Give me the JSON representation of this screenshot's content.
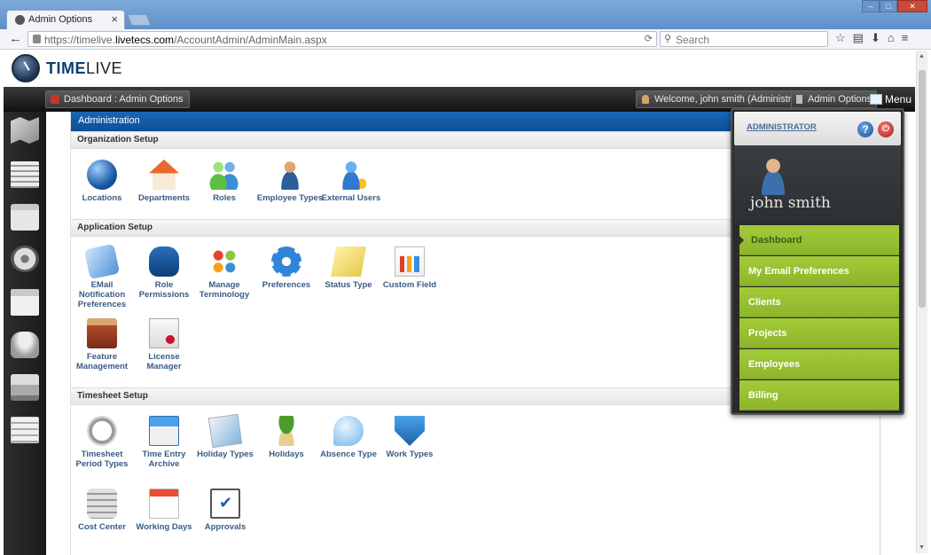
{
  "browser": {
    "tab_title": "Admin Options",
    "tab_close": "×",
    "url_prefix": "https://timelive.",
    "url_domain": "livetecs.com",
    "url_path": "/AccountAdmin/AdminMain.aspx",
    "search_placeholder": "Search",
    "back_glyph": "←",
    "reload_glyph": "⟳",
    "search_glyph": "⚲",
    "icons": [
      "☆",
      "▤",
      "⬇",
      "⌂",
      "≡"
    ],
    "window_buttons": [
      "–",
      "□",
      "✕"
    ]
  },
  "logo": {
    "part1": "TIME",
    "part2": "LIVE"
  },
  "topbar": {
    "breadcrumb": "Dashboard : Admin Options",
    "welcome": "Welcome, john smith (Administrator)",
    "admin_options": "Admin Options",
    "menu": "Menu"
  },
  "leftrail": {
    "icons": [
      "map-icon",
      "list-icon",
      "card-icon",
      "gauge-icon",
      "calendar-icon",
      "phone-icon",
      "printer-icon",
      "form-icon"
    ]
  },
  "admin": {
    "header": "Administration",
    "sections": {
      "organization": {
        "title": "Organization Setup",
        "items": [
          "Locations",
          "Departments",
          "Roles",
          "Employee Types",
          "External Users"
        ]
      },
      "application": {
        "title": "Application Setup",
        "items": [
          "EMail Notification Preferences",
          "Role Permissions",
          "Manage Terminology",
          "Preferences",
          "Status Type",
          "Custom Field",
          "Feature Management",
          "License Manager"
        ]
      },
      "timesheet": {
        "title": "Timesheet Setup",
        "items": [
          "Timesheet Period Types",
          "Time Entry Archive",
          "Holiday Types",
          "Holidays",
          "Absence Type",
          "Work Types",
          "Cost Center",
          "Working Days",
          "Approvals"
        ]
      }
    }
  },
  "menu_panel": {
    "role": "ADMINISTRATOR",
    "help": "?",
    "power": "⏻",
    "user_name": "john smith",
    "items": [
      "Dashboard",
      "My Email Preferences",
      "Clients",
      "Projects",
      "Employees",
      "Billing"
    ],
    "active_item": "Dashboard",
    "accent_color": "#9bc435"
  }
}
